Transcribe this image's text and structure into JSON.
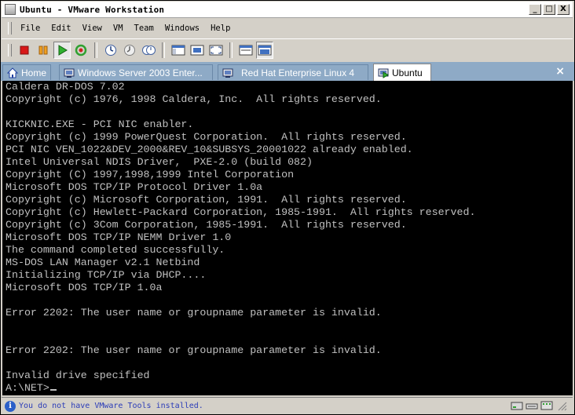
{
  "window": {
    "title": "Ubuntu - VMware Workstation",
    "minimize": "_",
    "maximize": "□",
    "close": "X"
  },
  "menu": [
    "File",
    "Edit",
    "View",
    "VM",
    "Team",
    "Windows",
    "Help"
  ],
  "toolbar": {
    "buttons": [
      "power-off",
      "suspend",
      "power-on",
      "reset",
      "snapshot",
      "revert-snapshot",
      "snapshot-manager",
      "show-sidebar",
      "quick-switch",
      "full-screen",
      "summary-view",
      "console-view"
    ]
  },
  "tabs": [
    {
      "label": "Home",
      "icon": "home-icon"
    },
    {
      "label": "Windows Server 2003 Enter...",
      "icon": "vm-icon"
    },
    {
      "label": "Red Hat Enterprise Linux 4",
      "icon": "vm-icon"
    },
    {
      "label": "Ubuntu",
      "icon": "vm-running-icon",
      "active": true
    }
  ],
  "tab_close": "×",
  "console": {
    "lines": [
      "Caldera DR-DOS 7.02",
      "Copyright (c) 1976, 1998 Caldera, Inc.  All rights reserved.",
      "",
      "KICKNIC.EXE - PCI NIC enabler.",
      "Copyright (c) 1999 PowerQuest Corporation.  All rights reserved.",
      "PCI NIC VEN_1022&DEV_2000&REV_10&SUBSYS_20001022 already enabled.",
      "Intel Universal NDIS Driver,  PXE-2.0 (build 082)",
      "Copyright (C) 1997,1998,1999 Intel Corporation",
      "Microsoft DOS TCP/IP Protocol Driver 1.0a",
      "Copyright (c) Microsoft Corporation, 1991.  All rights reserved.",
      "Copyright (c) Hewlett-Packard Corporation, 1985-1991.  All rights reserved.",
      "Copyright (c) 3Com Corporation, 1985-1991.  All rights reserved.",
      "Microsoft DOS TCP/IP NEMM Driver 1.0",
      "The command completed successfully.",
      "MS-DOS LAN Manager v2.1 Netbind",
      "Initializing TCP/IP via DHCP....",
      "Microsoft DOS TCP/IP 1.0a",
      "",
      "Error 2202: The user name or groupname parameter is invalid.",
      "",
      "",
      "Error 2202: The user name or groupname parameter is invalid.",
      "",
      "Invalid drive specified"
    ],
    "prompt": "A:\\NET>"
  },
  "status": {
    "info_icon": "i",
    "message": "You do not have VMware Tools installed."
  },
  "status_icons": [
    "hard-disk-icon",
    "floppy-icon",
    "network-icon",
    "resize-grip-icon"
  ]
}
